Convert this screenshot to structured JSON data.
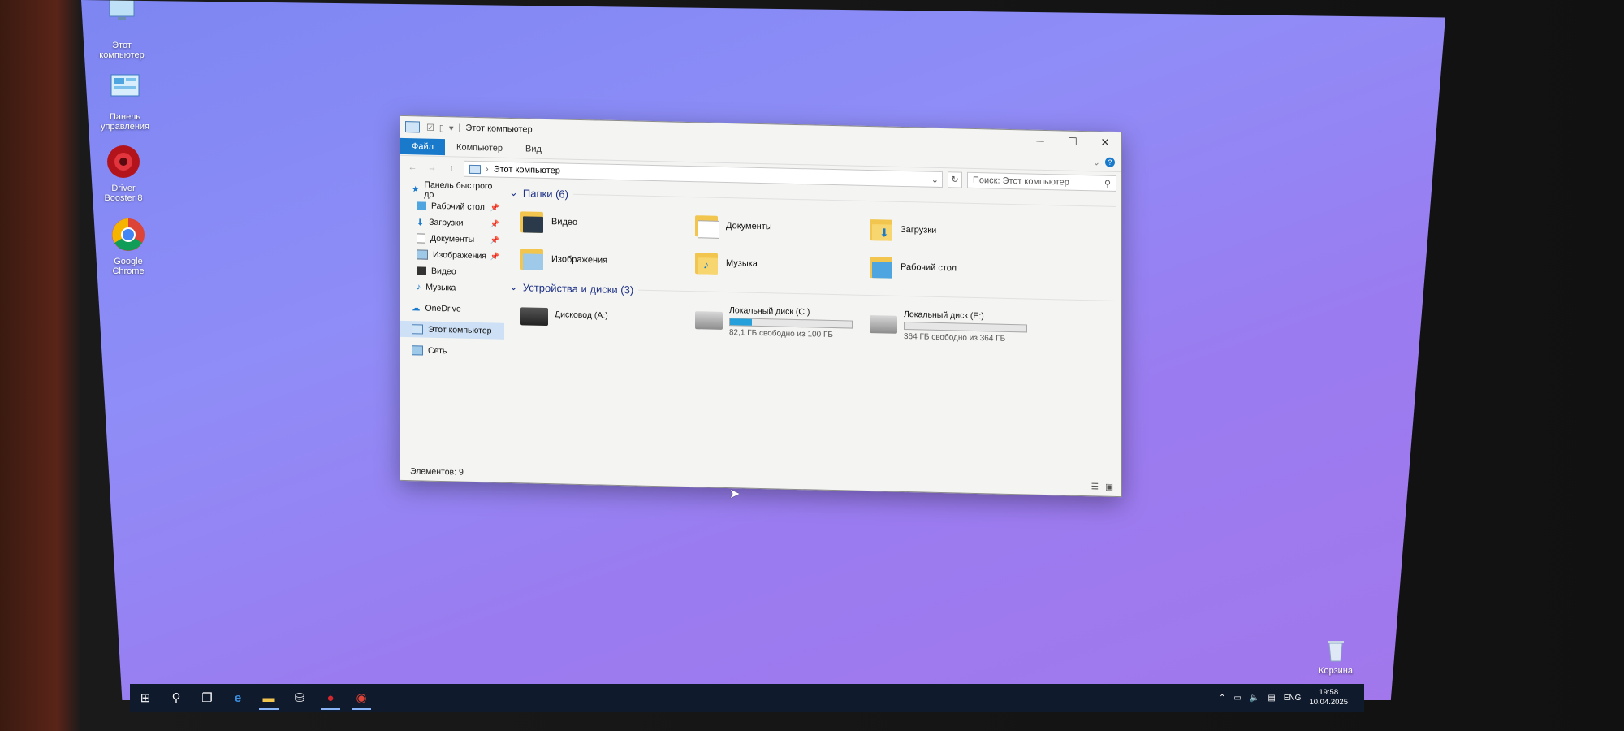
{
  "desktop": {
    "icons": [
      {
        "label_line1": "Этот",
        "label_line2": "компьютер"
      },
      {
        "label_line1": "Панель",
        "label_line2": "управления"
      },
      {
        "label_line1": "Driver",
        "label_line2": "Booster 8"
      },
      {
        "label_line1": "Google",
        "label_line2": "Chrome"
      }
    ],
    "recycle_bin": "Корзина"
  },
  "window": {
    "title": "Этот компьютер",
    "quick_access_sep": "|",
    "ribbon_tabs": [
      "Файл",
      "Компьютер",
      "Вид"
    ],
    "address": "Этот компьютер",
    "search_placeholder": "Поиск: Этот компьютер",
    "nav": {
      "quick_access": "Панель быстрого до",
      "items": [
        "Рабочий стол",
        "Загрузки",
        "Документы",
        "Изображения",
        "Видео",
        "Музыка"
      ],
      "onedrive": "OneDrive",
      "this_pc": "Этот компьютер",
      "network": "Сеть"
    },
    "folders_header": "Папки (6)",
    "folders": [
      "Видео",
      "Документы",
      "Загрузки",
      "Изображения",
      "Музыка",
      "Рабочий стол"
    ],
    "devices_header": "Устройства и диски (3)",
    "drives": [
      {
        "name": "Дисковод (A:)",
        "detail": "",
        "used_fraction": null
      },
      {
        "name": "Локальный диск (C:)",
        "detail": "82,1 ГБ свободно из 100 ГБ",
        "used_fraction": 0.179
      },
      {
        "name": "Локальный диск (E:)",
        "detail": "364 ГБ свободно из 364 ГБ",
        "used_fraction": 0.0
      }
    ],
    "status": "Элементов: 9"
  },
  "taskbar": {
    "lang": "ENG",
    "time": "19:58",
    "date": "10.04.2025"
  },
  "colors": {
    "accent": "#1979ca",
    "drive_fill": "#26a0da",
    "desktop_bg": "#8f8df7",
    "taskbar_bg": "#0f1a2c"
  }
}
